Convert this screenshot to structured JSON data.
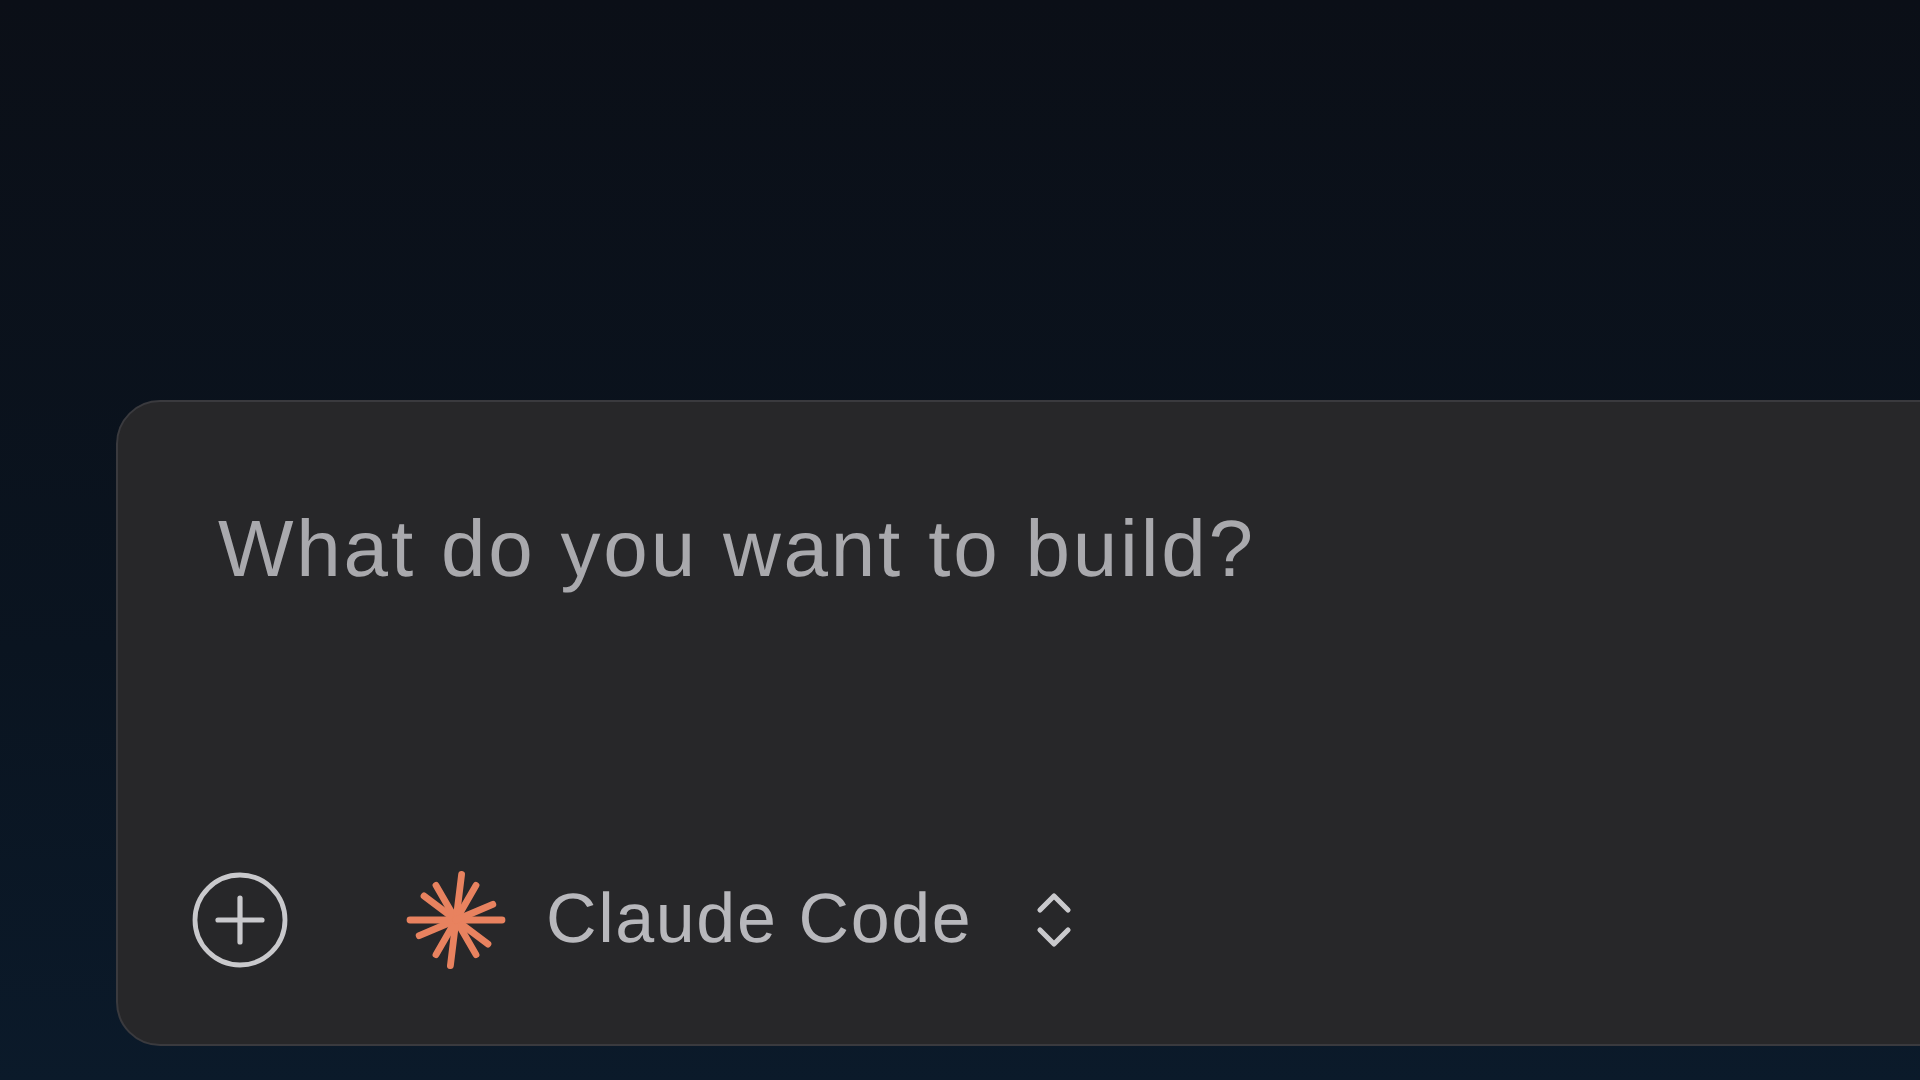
{
  "prompt": {
    "placeholder": "What do you want to build?"
  },
  "model_selector": {
    "label": "Claude Code"
  }
}
